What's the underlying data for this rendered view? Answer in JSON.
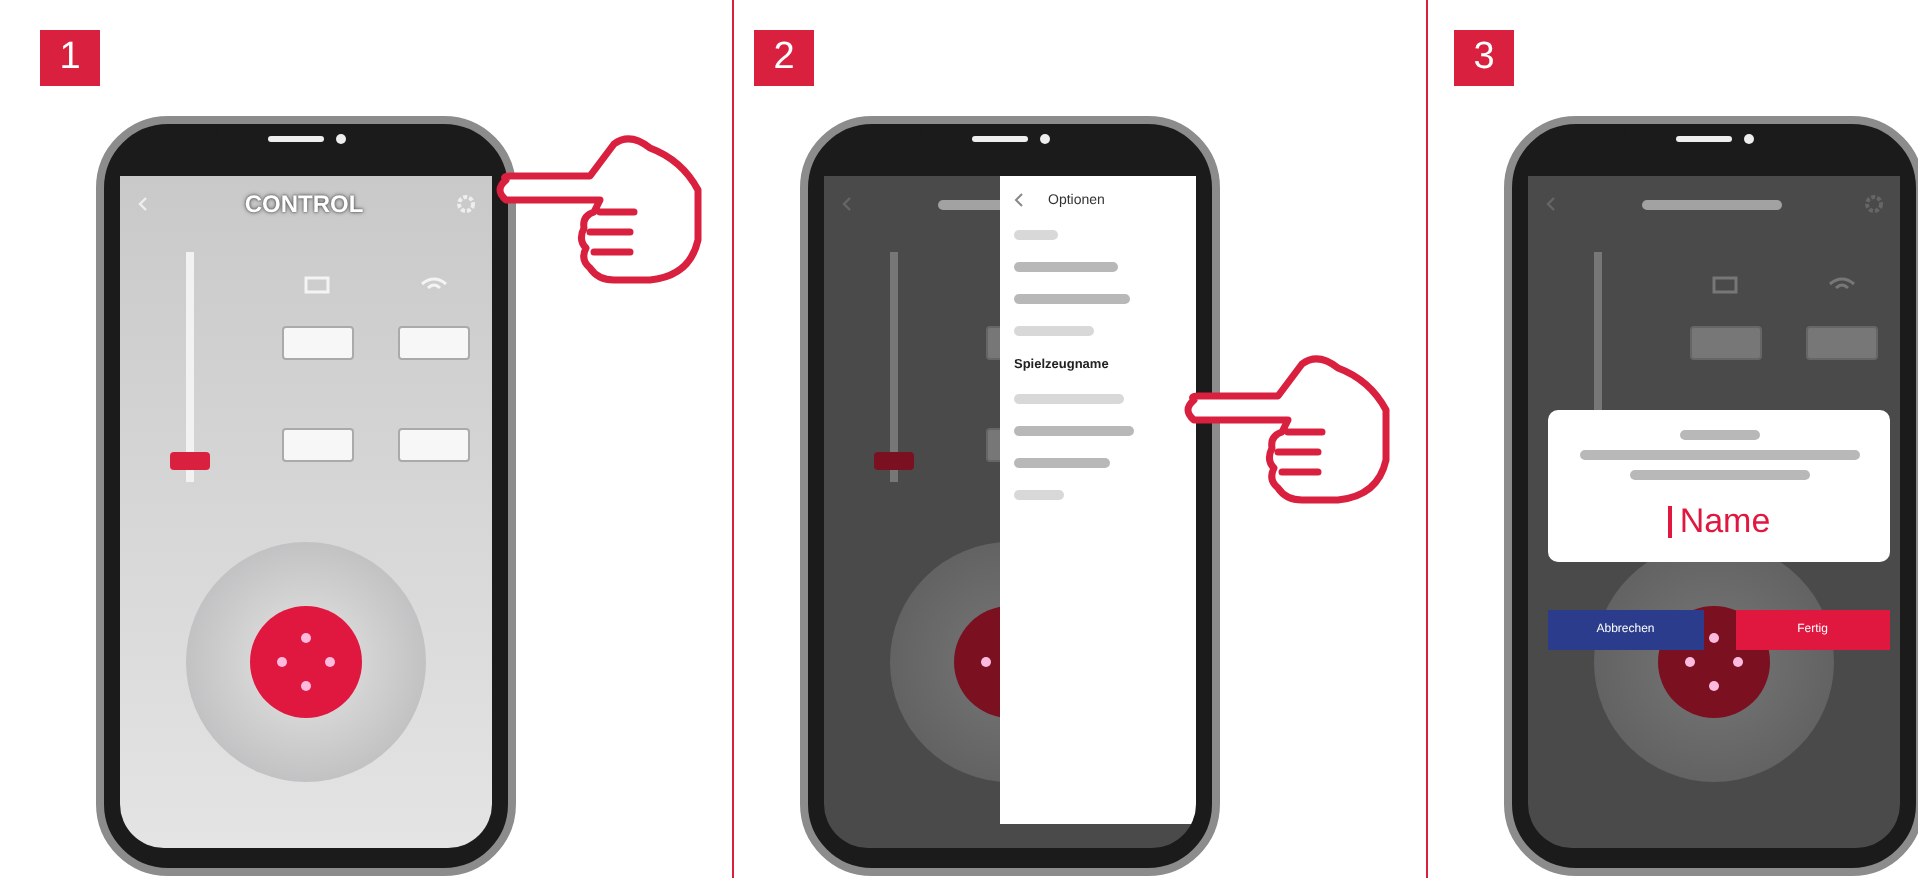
{
  "steps": [
    {
      "number": "1",
      "screen": {
        "kind": "control",
        "title": "CONTROL",
        "slider": {
          "level": 0.05
        }
      }
    },
    {
      "number": "2",
      "screen": {
        "kind": "options",
        "slider": {
          "level": 0.05
        },
        "menu": {
          "title": "Optionen",
          "items": [
            {
              "label": "Spielzeugname"
            }
          ]
        }
      }
    },
    {
      "number": "3",
      "screen": {
        "kind": "rename",
        "dialog": {
          "value": "Name",
          "buttons": [
            {
              "label": "Abbrechen",
              "kind": "cancel"
            },
            {
              "label": "Fertig",
              "kind": "confirm"
            }
          ]
        }
      }
    }
  ]
}
